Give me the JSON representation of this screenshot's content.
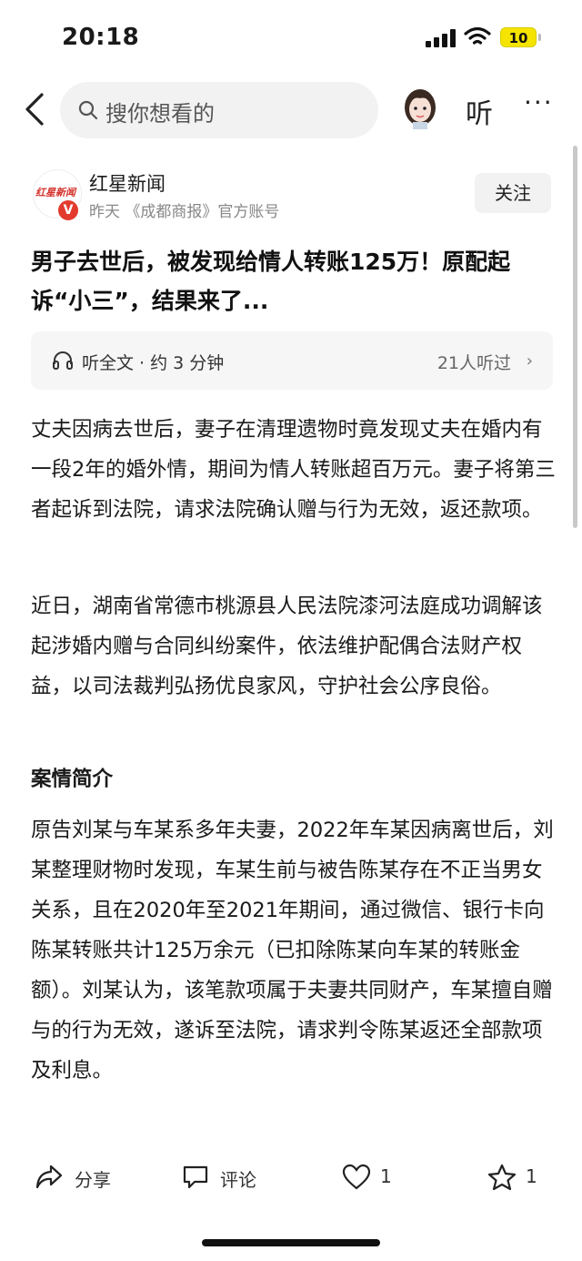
{
  "status": {
    "time": "20:18",
    "battery": "10"
  },
  "nav": {
    "search_placeholder": "搜你想看的",
    "listen_label": "听",
    "more_label": "···"
  },
  "account": {
    "logo_text": "红星新闻",
    "verified_badge": "V",
    "name": "红星新闻",
    "meta": "昨天 《成都商报》官方账号",
    "follow_label": "关注"
  },
  "article": {
    "title": "男子去世后，被发现给情人转账125万！原配起诉“小三”，结果来了...",
    "listen_bar": {
      "label": "听全文 · 约 3 分钟",
      "count": "21人听过",
      "chevron": "›"
    },
    "paragraph_1": "丈夫因病去世后，妻子在清理遗物时竟发现丈夫在婚内有一段2年的婚外情，期间为情人转账超百万元。妻子将第三者起诉到法院，请求法院确认赠与行为无效，返还款项。",
    "paragraph_2": "近日，湖南省常德市桃源县人民法院漆河法庭成功调解该起涉婚内赠与合同纠纷案件，依法维护配偶合法财产权益，以司法裁判弘扬优良家风，守护社会公序良俗。",
    "section_title": "案情简介",
    "paragraph_3": "原告刘某与车某系多年夫妻，2022年车某因病离世后，刘某整理财物时发现，车某生前与被告陈某存在不正当男女关系，且在2020年至2021年期间，通过微信、银行卡向陈某转账共计125万余元（已扣除陈某向车某的转账金额）。刘某认为，该笔款项属于夫妻共同财产，车某擅自赠与的行为无效，遂诉至法院，请求判令陈某返还全部款项及利息。"
  },
  "actions": {
    "share_label": "分享",
    "comment_label": "评论",
    "like_count": "1",
    "favorite_count": "1"
  },
  "icons": {
    "back": "chevron-left-icon",
    "search": "search-icon",
    "headphone": "headphone-icon",
    "share": "share-icon",
    "comment": "comment-icon",
    "like": "heart-icon",
    "favorite": "star-icon"
  },
  "colors": {
    "brand_red": "#e23b2e",
    "battery_yellow": "#f5e400"
  }
}
